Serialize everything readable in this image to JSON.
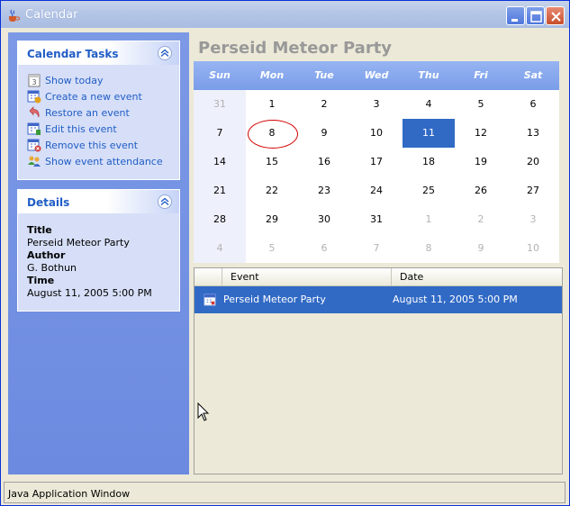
{
  "window": {
    "title": "Calendar"
  },
  "sidebar": {
    "tasks_title": "Calendar Tasks",
    "tasks": [
      {
        "label": "Show today",
        "icon": "calendar-day-icon"
      },
      {
        "label": "Create a new event",
        "icon": "calendar-add-icon"
      },
      {
        "label": "Restore an event",
        "icon": "undo-arrow-icon"
      },
      {
        "label": "Edit this event",
        "icon": "calendar-edit-icon"
      },
      {
        "label": "Remove this event",
        "icon": "calendar-remove-icon"
      },
      {
        "label": "Show event attendance",
        "icon": "people-icon"
      }
    ],
    "details_title": "Details",
    "details": [
      {
        "label": "Title",
        "value": "Perseid Meteor Party"
      },
      {
        "label": "Author",
        "value": "G. Bothun"
      },
      {
        "label": "Time",
        "value": "August 11, 2005 5:00 PM"
      }
    ]
  },
  "main": {
    "event_title": "Perseid Meteor Party",
    "days_of_week": [
      "Sun",
      "Mon",
      "Tue",
      "Wed",
      "Thu",
      "Fri",
      "Sat"
    ],
    "weeks": [
      [
        "31",
        "1",
        "2",
        "3",
        "4",
        "5",
        "6"
      ],
      [
        "7",
        "8",
        "9",
        "10",
        "11",
        "12",
        "13"
      ],
      [
        "14",
        "15",
        "16",
        "17",
        "18",
        "19",
        "20"
      ],
      [
        "21",
        "22",
        "23",
        "24",
        "25",
        "26",
        "27"
      ],
      [
        "28",
        "29",
        "30",
        "31",
        "1",
        "2",
        "3"
      ],
      [
        "4",
        "5",
        "6",
        "7",
        "8",
        "9",
        "10"
      ]
    ],
    "selected_day": "11",
    "circled_day": "8",
    "table": {
      "columns": [
        "Event",
        "Date"
      ],
      "rows": [
        {
          "event": "Perseid Meteor Party",
          "date": "August 11, 2005 5:00 PM"
        }
      ]
    }
  },
  "status": {
    "text": "Java Application Window"
  },
  "colors": {
    "accent": "#316ac5",
    "link": "#215dc6",
    "sidebar": "#7c99e6",
    "circle": "#d40000"
  }
}
